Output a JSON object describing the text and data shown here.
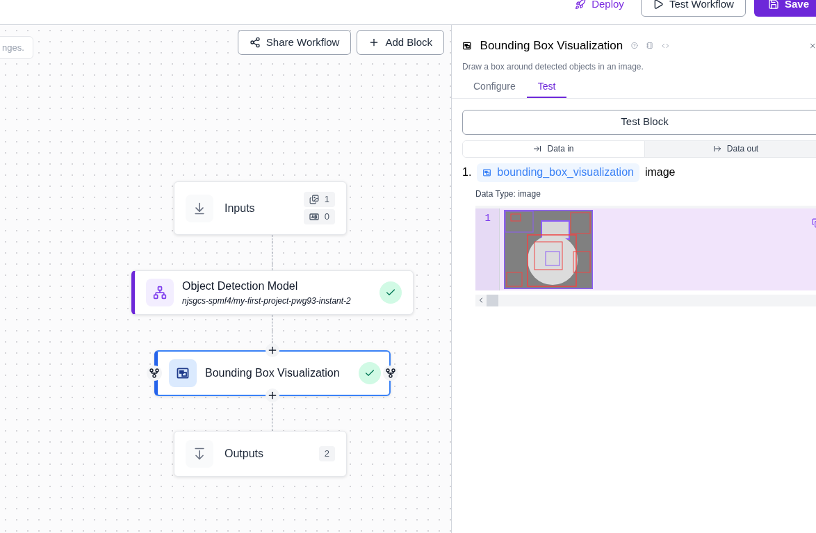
{
  "top_bar": {
    "buttons": [
      {
        "kind": "link",
        "label": "Deploy"
      },
      {
        "kind": "outline",
        "label": "Test Workflow"
      },
      {
        "kind": "primary",
        "label": "Save"
      }
    ]
  },
  "canvas": {
    "notice": "nges.",
    "toolbar": [
      {
        "kind": "share",
        "label": "Share Workflow"
      },
      {
        "kind": "add",
        "label": "Add Block"
      }
    ],
    "nodes": [
      {
        "kind": "input",
        "title": "Inputs",
        "counts": [
          {
            "value": "1"
          },
          {
            "kind": "text",
            "value": "0"
          }
        ],
        "selected": false
      },
      {
        "kind": "model",
        "title": "Object Detection Model",
        "subtitle": "njsgcs-spmf4/my-first-project-pwg93-instant-2",
        "done": true,
        "selected": false
      },
      {
        "kind": "visualization",
        "title": "Bounding Box Visualization",
        "done": true,
        "selected": true
      },
      {
        "kind": "output",
        "title": "Outputs",
        "count": "2",
        "selected": false
      }
    ]
  },
  "panel": {
    "title": "Bounding Box Visualization",
    "description": "Draw a box around detected objects in an image.",
    "tabs": [
      {
        "label": "Configure",
        "selected": false
      },
      {
        "label": "Test",
        "selected": true
      }
    ],
    "test_button": "Test Block",
    "data_tabs": [
      {
        "kind": "in",
        "label": "Data in",
        "selected": true
      },
      {
        "kind": "out",
        "label": "Data out",
        "selected": false
      }
    ],
    "outputs": [
      {
        "index": "1.",
        "name": "bounding_box_visualization",
        "type": "image",
        "data_type": "Data Type: image",
        "line": "1"
      }
    ]
  }
}
